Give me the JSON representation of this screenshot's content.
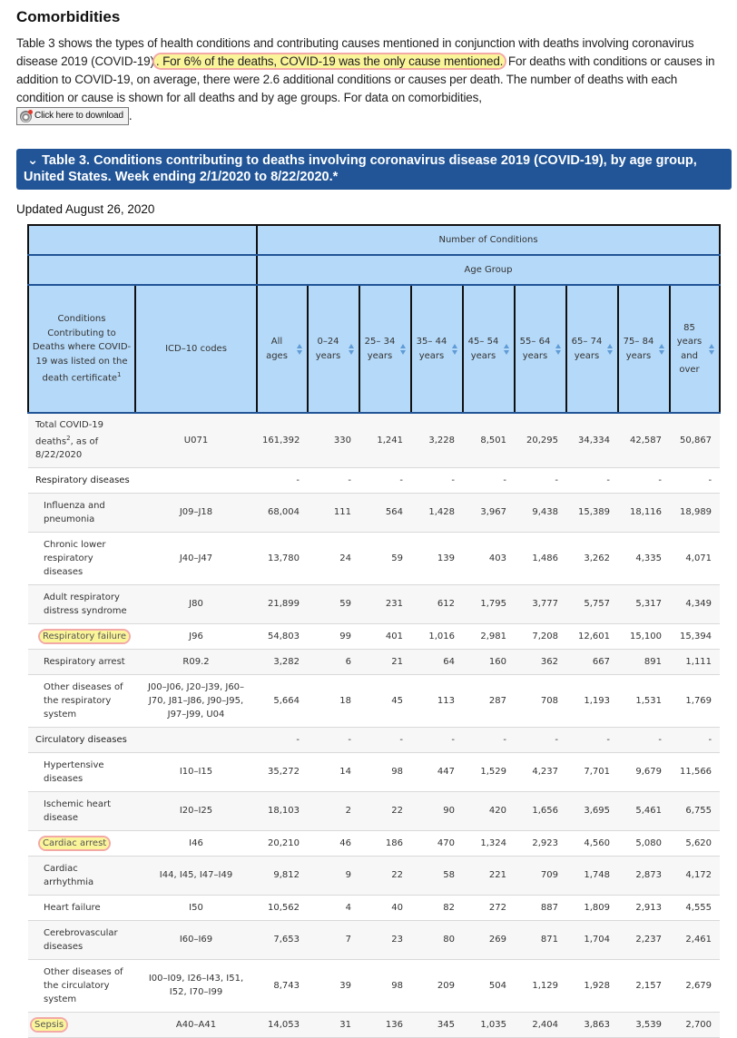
{
  "section": {
    "title": "Comorbidities",
    "intro_before": "Table 3 shows the types of health conditions and contributing causes mentioned in conjunction with deaths involving coronavirus disease 2019 (COVID-19)",
    "intro_highlight": ". For 6% of the deaths, COVID-19 was the only cause mentioned.",
    "intro_after": " For deaths with conditions or causes in addition to COVID-19, on average, there were 2.6 additional conditions or causes per death. The number of deaths with each condition or cause is shown for all deaths and by age groups. For data on comorbidities,",
    "download_label": "Click here to download",
    "download_icon": "download-disc-icon",
    "trailing": ".",
    "highlight_color": "#fbf59a",
    "highlight_border": "#f3a9a6"
  },
  "accordion": {
    "chevron": "⌄",
    "title": "Table 3. Conditions contributing to deaths involving coronavirus disease 2019 (COVID-19), by age group, United States. Week ending 2/1/2020 to 8/22/2020.*",
    "color": "#215597"
  },
  "updated": "Updated August 26, 2020",
  "table": {
    "header_top": "Number of Conditions",
    "header_group": "Age Group",
    "col_condition": "Conditions Contributing to Deaths where COVID-19 was listed on the death certificate",
    "col_condition_sup": "1",
    "col_icd": "ICD–10 codes",
    "age_columns": [
      "All ages",
      "0–24 years",
      "25– 34 years",
      "35– 44 years",
      "45– 54 years",
      "55– 64 years",
      "65– 74 years",
      "75– 84 years",
      "85 years and over"
    ],
    "header_bg": "#b5d9f8",
    "rows": [
      {
        "condition": "Total COVID-19 deaths",
        "sup": "2",
        "condition_suffix": ", as of 8/22/2020",
        "icd": "U071",
        "values": [
          "161,392",
          "330",
          "1,241",
          "3,228",
          "8,501",
          "20,295",
          "34,334",
          "42,587",
          "50,867"
        ],
        "type": "total",
        "highlight": false
      },
      {
        "condition": "Respiratory diseases",
        "icd": "",
        "values": [
          "-",
          "-",
          "-",
          "-",
          "-",
          "-",
          "-",
          "-",
          "-"
        ],
        "type": "category",
        "highlight": false
      },
      {
        "condition": "Influenza and pneumonia",
        "icd": "J09–J18",
        "values": [
          "68,004",
          "111",
          "564",
          "1,428",
          "3,967",
          "9,438",
          "15,389",
          "18,116",
          "18,989"
        ],
        "type": "sub",
        "highlight": false
      },
      {
        "condition": "Chronic lower respiratory diseases",
        "icd": "J40–J47",
        "values": [
          "13,780",
          "24",
          "59",
          "139",
          "403",
          "1,486",
          "3,262",
          "4,335",
          "4,071"
        ],
        "type": "sub",
        "highlight": false
      },
      {
        "condition": "Adult respiratory distress syndrome",
        "icd": "J80",
        "values": [
          "21,899",
          "59",
          "231",
          "612",
          "1,795",
          "3,777",
          "5,757",
          "5,317",
          "4,349"
        ],
        "type": "sub",
        "highlight": false
      },
      {
        "condition": "Respiratory failure",
        "icd": "J96",
        "values": [
          "54,803",
          "99",
          "401",
          "1,016",
          "2,981",
          "7,208",
          "12,601",
          "15,100",
          "15,394"
        ],
        "type": "sub",
        "highlight": true
      },
      {
        "condition": "Respiratory arrest",
        "icd": "R09.2",
        "values": [
          "3,282",
          "6",
          "21",
          "64",
          "160",
          "362",
          "667",
          "891",
          "1,111"
        ],
        "type": "sub",
        "highlight": false
      },
      {
        "condition": "Other diseases of the respiratory system",
        "icd": "J00–J06, J20–J39, J60–J70, J81–J86, J90–J95, J97–J99, U04",
        "values": [
          "5,664",
          "18",
          "45",
          "113",
          "287",
          "708",
          "1,193",
          "1,531",
          "1,769"
        ],
        "type": "sub",
        "highlight": false
      },
      {
        "condition": "Circulatory diseases",
        "icd": "",
        "values": [
          "-",
          "-",
          "-",
          "-",
          "-",
          "-",
          "-",
          "-",
          "-"
        ],
        "type": "category",
        "highlight": false
      },
      {
        "condition": "Hypertensive diseases",
        "icd": "I10–I15",
        "values": [
          "35,272",
          "14",
          "98",
          "447",
          "1,529",
          "4,237",
          "7,701",
          "9,679",
          "11,566"
        ],
        "type": "sub",
        "highlight": false
      },
      {
        "condition": "Ischemic heart disease",
        "icd": "I20–I25",
        "values": [
          "18,103",
          "2",
          "22",
          "90",
          "420",
          "1,656",
          "3,695",
          "5,461",
          "6,755"
        ],
        "type": "sub",
        "highlight": false
      },
      {
        "condition": "Cardiac arrest",
        "icd": "I46",
        "values": [
          "20,210",
          "46",
          "186",
          "470",
          "1,324",
          "2,923",
          "4,560",
          "5,080",
          "5,620"
        ],
        "type": "sub",
        "highlight": true
      },
      {
        "condition": "Cardiac arrhythmia",
        "icd": "I44, I45, I47–I49",
        "values": [
          "9,812",
          "9",
          "22",
          "58",
          "221",
          "709",
          "1,748",
          "2,873",
          "4,172"
        ],
        "type": "sub",
        "highlight": false
      },
      {
        "condition": "Heart failure",
        "icd": "I50",
        "values": [
          "10,562",
          "4",
          "40",
          "82",
          "272",
          "887",
          "1,809",
          "2,913",
          "4,555"
        ],
        "type": "sub",
        "highlight": false
      },
      {
        "condition": "Cerebrovascular diseases",
        "icd": "I60–I69",
        "values": [
          "7,653",
          "7",
          "23",
          "80",
          "269",
          "871",
          "1,704",
          "2,237",
          "2,461"
        ],
        "type": "sub",
        "highlight": false
      },
      {
        "condition": "Other diseases of the circulatory system",
        "icd": "I00–I09, I26–I43, I51, I52, I70–I99",
        "values": [
          "8,743",
          "39",
          "98",
          "209",
          "504",
          "1,129",
          "1,928",
          "2,157",
          "2,679"
        ],
        "type": "sub",
        "highlight": false
      },
      {
        "condition": "Sepsis",
        "icd": "A40–A41",
        "values": [
          "14,053",
          "31",
          "136",
          "345",
          "1,035",
          "2,404",
          "3,863",
          "3,539",
          "2,700"
        ],
        "type": "category",
        "highlight": true
      }
    ]
  }
}
